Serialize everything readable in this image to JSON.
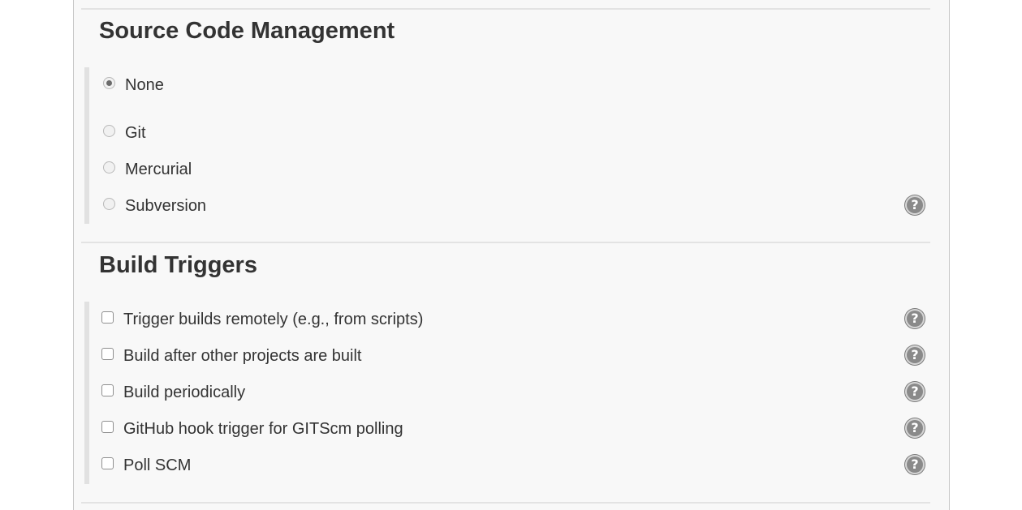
{
  "scm": {
    "title": "Source Code Management",
    "options": [
      {
        "label": "None",
        "selected": true
      },
      {
        "label": "Git",
        "selected": false
      },
      {
        "label": "Mercurial",
        "selected": false
      },
      {
        "label": "Subversion",
        "selected": false
      }
    ],
    "help_glyph": "?"
  },
  "triggers": {
    "title": "Build Triggers",
    "items": [
      {
        "label": "Trigger builds remotely (e.g., from scripts)",
        "checked": false
      },
      {
        "label": "Build after other projects are built",
        "checked": false
      },
      {
        "label": "Build periodically",
        "checked": false
      },
      {
        "label": "GitHub hook trigger for GITScm polling",
        "checked": false
      },
      {
        "label": "Poll SCM",
        "checked": false
      }
    ],
    "help_glyph": "?"
  },
  "icons": {
    "help": "question-mark-circle-icon"
  },
  "colors": {
    "help_icon": "#8a8a8a",
    "group_bar": "#e1e1e1",
    "panel_bg": "#f8f8f8"
  }
}
